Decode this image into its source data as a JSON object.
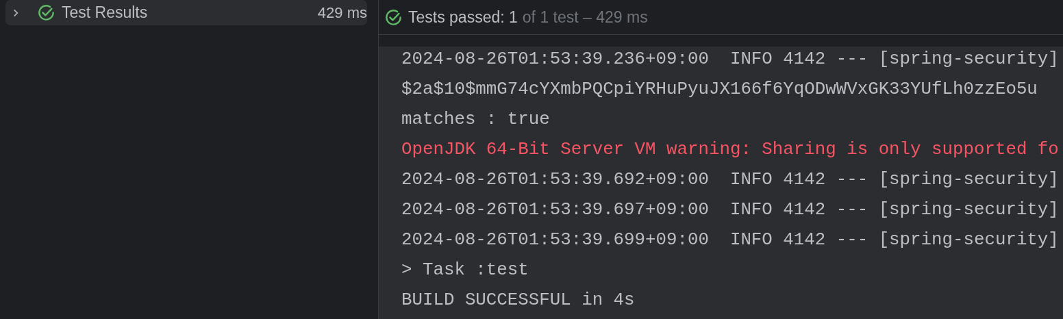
{
  "tree": {
    "items": [
      {
        "label": "Test Results",
        "time": "429 ms",
        "passed": true,
        "expanded": false,
        "selected": true
      }
    ]
  },
  "summary": {
    "passed": true,
    "label": "Tests passed: 1",
    "detail": "of 1 test – 429 ms"
  },
  "console": {
    "lines": [
      {
        "kind": "info",
        "text": "2024-08-26T01:53:39.236+09:00  INFO 4142 --- [spring-security]"
      },
      {
        "kind": "info",
        "text": "$2a$10$mmG74cYXmbPQCpiYRHuPyuJX166f6YqODwWVxGK33YUfLh0zzEo5u"
      },
      {
        "kind": "info",
        "text": "matches : true"
      },
      {
        "kind": "error",
        "text": "OpenJDK 64-Bit Server VM warning: Sharing is only supported fo"
      },
      {
        "kind": "info",
        "text": "2024-08-26T01:53:39.692+09:00  INFO 4142 --- [spring-security]"
      },
      {
        "kind": "info",
        "text": "2024-08-26T01:53:39.697+09:00  INFO 4142 --- [spring-security]"
      },
      {
        "kind": "info",
        "text": "2024-08-26T01:53:39.699+09:00  INFO 4142 --- [spring-security]"
      },
      {
        "kind": "info",
        "text": "> Task :test"
      },
      {
        "kind": "info",
        "text": "BUILD SUCCESSFUL in 4s"
      }
    ]
  }
}
